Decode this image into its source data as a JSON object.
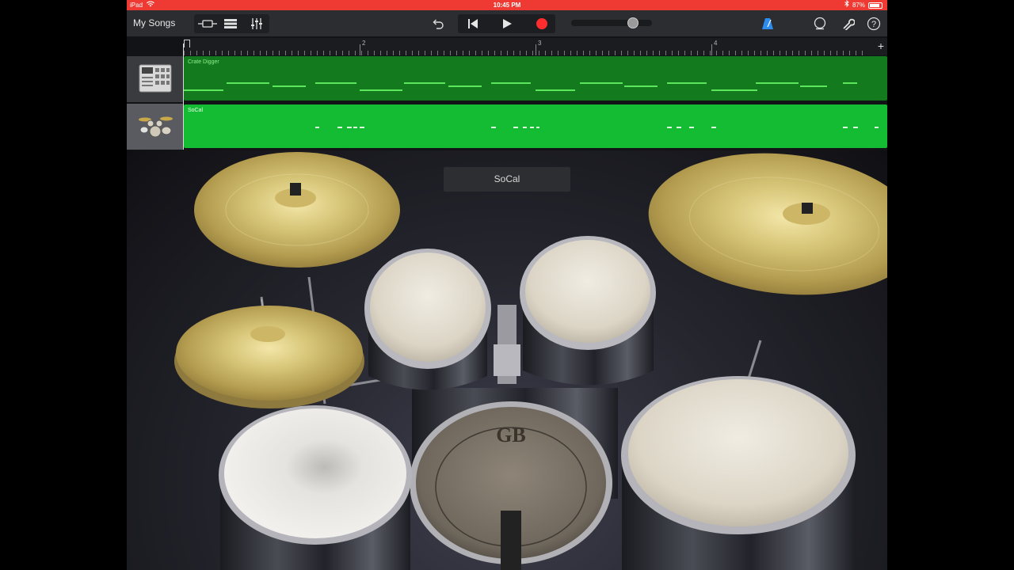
{
  "status_bar": {
    "device": "iPad",
    "time": "10:45 PM",
    "battery": "87%"
  },
  "toolbar": {
    "my_songs_label": "My Songs",
    "icons": {
      "browser": "browser-view-icon",
      "tracks": "tracks-view-icon",
      "mixer": "mixer-icon",
      "undo": "undo-icon",
      "rewind": "go-to-start-icon",
      "play": "play-icon",
      "record": "record-icon",
      "metronome": "metronome-icon",
      "loop": "loop-icon",
      "settings": "wrench-icon",
      "help": "help-icon"
    }
  },
  "ruler": {
    "bars": [
      "2",
      "3",
      "4"
    ]
  },
  "tracks": [
    {
      "name": "Crate Digger",
      "instrument_icon": "beat-sequencer-icon",
      "color": "#137a1d"
    },
    {
      "name": "SoCal",
      "instrument_icon": "drum-kit-icon",
      "color": "#14bc34"
    }
  ],
  "kit": {
    "name": "SoCal",
    "bass_drum_logo": "GB"
  },
  "colors": {
    "status_bar": "#ee3a32",
    "record": "#ff2d2d",
    "metronome": "#2d8cf0"
  }
}
